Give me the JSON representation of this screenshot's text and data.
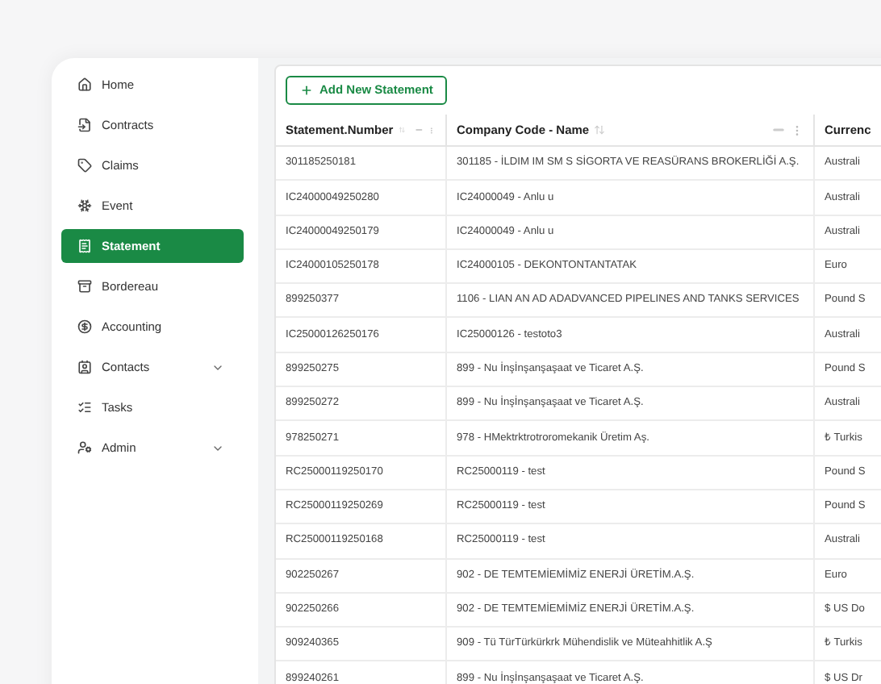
{
  "sidebar": {
    "items": [
      {
        "label": "Home",
        "selected": false,
        "has_submenu": false
      },
      {
        "label": "Contracts",
        "selected": false,
        "has_submenu": false
      },
      {
        "label": "Claims",
        "selected": false,
        "has_submenu": false
      },
      {
        "label": "Event",
        "selected": false,
        "has_submenu": false
      },
      {
        "label": "Statement",
        "selected": true,
        "has_submenu": false
      },
      {
        "label": "Bordereau",
        "selected": false,
        "has_submenu": false
      },
      {
        "label": "Accounting",
        "selected": false,
        "has_submenu": false
      },
      {
        "label": "Contacts",
        "selected": false,
        "has_submenu": true
      },
      {
        "label": "Tasks",
        "selected": false,
        "has_submenu": false
      },
      {
        "label": "Admin",
        "selected": false,
        "has_submenu": true
      }
    ]
  },
  "toolbar": {
    "add_button": "Add New Statement"
  },
  "table": {
    "columns": [
      {
        "label": "Statement.Number",
        "sortable": true,
        "menu": true
      },
      {
        "label": "Company Code - Name",
        "sortable": true,
        "menu": true
      },
      {
        "label": "Currenc"
      }
    ],
    "rows": [
      [
        "301185250181",
        "301185 - İLDIM IM SM S SİGORTA VE REASÜRANS BROKERLİĞİ A.Ş.",
        "Australi"
      ],
      [
        "IC24000049250280",
        "IC24000049 - Anlu u",
        "Australi"
      ],
      [
        "IC24000049250179",
        "IC24000049 - Anlu u",
        "Australi"
      ],
      [
        "IC24000105250178",
        "IC24000105 - DEKONTONTANTATAK",
        "Euro"
      ],
      [
        "899250377",
        "1106 - LIAN AN AD ADADVANCED PIPELINES AND TANKS SERVICES",
        "Pound S"
      ],
      [
        "IC25000126250176",
        "IC25000126 - testoto3",
        "Australi"
      ],
      [
        "899250275",
        "899 - Nu İnşİnşanşaşaat ve Ticaret A.Ş.",
        "Pound S"
      ],
      [
        "899250272",
        "899 - Nu İnşİnşanşaşaat ve Ticaret A.Ş.",
        "Australi"
      ],
      [
        "978250271",
        "978 - HMektrktrotroromekanik Üretim Aş.",
        "₺ Turkis"
      ],
      [
        "RC25000119250170",
        "RC25000119 - test",
        "Pound S"
      ],
      [
        "RC25000119250269",
        "RC25000119 - test",
        "Pound S"
      ],
      [
        "RC25000119250168",
        "RC25000119 - test",
        "Australi"
      ],
      [
        "902250267",
        "902 - DE TEMTEMİEMİMİZ ENERJİ ÜRETİM.A.Ş.",
        "Euro"
      ],
      [
        "902250266",
        "902 - DE TEMTEMİEMİMİZ ENERJİ ÜRETİM.A.Ş.",
        "$ US Do"
      ],
      [
        "909240365",
        "909 - Tü TürTürkürkrk Mühendislik ve Müteahhitlik A.Ş",
        "₺ Turkis"
      ],
      [
        "899240261",
        "899 - Nu İnşİnşanşaşaat ve Ticaret A.Ş.",
        "$ US Dr"
      ]
    ]
  }
}
